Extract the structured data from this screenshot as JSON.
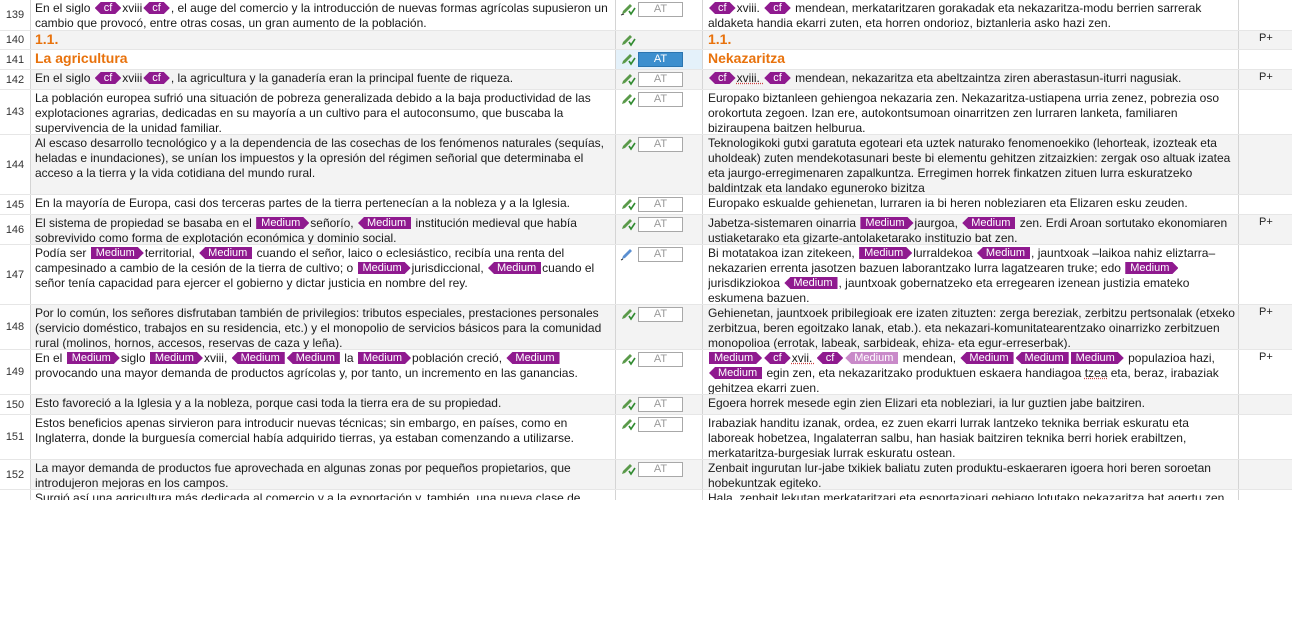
{
  "colors": {
    "tag": "#8f1a8f",
    "tag_light": "#c98ac9",
    "heading": "#e8720c",
    "active_status": "#3c8fce"
  },
  "tag_labels": {
    "cf": "cf",
    "medium": "Medium"
  },
  "icons": {
    "edit": "pencil-check-icon",
    "edit_plain": "pencil-icon"
  },
  "rows": [
    {
      "num": "139",
      "status": "AT",
      "flag": "",
      "src": {
        "a": "En el siglo ",
        "b": "xviii",
        "c": ", el auge del comercio y la introducción de nuevas formas agrícolas supusieron un cambio que provocó, entre otras cosas, un gran aumento de la población."
      },
      "tgt": {
        "a": "xviii. ",
        "b": " mendean, merkataritzaren gorakadak eta nekazaritza-modu berrien sarrerak aldaketa handia ekarri zuten, eta horren ondorioz, biztanleria asko hazi zen."
      }
    },
    {
      "num": "140",
      "status": "",
      "flag": "P+",
      "src": "1.1.",
      "tgt": "1.1."
    },
    {
      "num": "141",
      "status": "AT",
      "flag": "",
      "src": "La agricultura",
      "tgt": "Nekazaritza"
    },
    {
      "num": "142",
      "status": "AT",
      "flag": "P+",
      "src": {
        "a": "En el siglo ",
        "b": "xviii",
        "c": ", la agricultura y la ganadería eran la principal fuente de riqueza."
      },
      "tgt": {
        "a": "xviii. ",
        "b": " mendean, nekazaritza eta abeltzaintza ziren aberastasun-iturri nagusiak."
      }
    },
    {
      "num": "143",
      "status": "AT",
      "flag": "",
      "src": "La población europea sufrió una situación de pobreza generalizada debido a la baja productividad de las explotaciones agrarias, dedicadas en su mayoría a un cultivo para el autoconsumo, que buscaba la supervivencia de la unidad familiar.",
      "tgt": "Europako biztanleen gehiengoa nekazaria zen. Nekazaritza-ustiapena urria zenez, pobrezia oso orokortuta zegoen. Izan ere, autokontsumoan oinarritzen zen lurraren lanketa, familiaren biziraupena baitzen helburua."
    },
    {
      "num": "144",
      "status": "AT",
      "flag": "",
      "src": "Al escaso desarrollo tecnológico y a la dependencia de las cosechas de los fenómenos naturales (sequías, heladas e inundaciones), se unían los impuestos y la opresión del régimen señorial que determinaba el acceso a la tierra y la vida cotidiana del mundo rural.",
      "tgt": "Teknologikoki gutxi garatuta egoteari eta uztek naturako fenomenoekiko (lehorteak, izozteak eta uholdeak) zuten mendekotasunari beste bi elementu gehitzen zitzaizkien: zergak oso altuak izatea eta jaurgo-erregimenaren zapalkuntza. Erregimen horrek finkatzen zituen lurra eskuratzeko baldintzak eta landako eguneroko bizitza"
    },
    {
      "num": "145",
      "status": "AT",
      "flag": "",
      "src": "En la mayoría de Europa, casi dos terceras partes de la tierra pertenecían a la nobleza y a la Iglesia.",
      "tgt": "Europako eskualde gehienetan, lurraren ia bi heren nobleziaren eta Elizaren esku zeuden."
    },
    {
      "num": "146",
      "status": "AT",
      "flag": "P+",
      "src": {
        "a": "El sistema de propiedad se basaba en el ",
        "b": "señorío, ",
        "c": " institución medieval que había sobrevivido como forma de explotación económica y dominio social."
      },
      "tgt": {
        "a": "Jabetza-sistemaren oinarria ",
        "b": "jaurgoa, ",
        "c": " zen. Erdi Aroan sortutako ekonomiaren ustiaketarako eta  gizarte-antolaketarako instituzio bat zen."
      }
    },
    {
      "num": "147",
      "status": "AT",
      "flag": "",
      "src": {
        "a": "Podía ser ",
        "b": "territorial, ",
        "c": " cuando el señor, laico o eclesiástico, recibía una renta del campesinado a cambio de la cesión de la tierra de cultivo; o ",
        "d": "jurisdiccional, ",
        "e": "cuando el señor tenía capacidad para ejercer el gobierno y dictar justicia en nombre del rey."
      },
      "tgt": {
        "a": "Bi motatakoa izan zitekeen, ",
        "b": "lurraldekoa ",
        "c": ", jauntxoak –laikoa nahiz eliztarra– nekazarien errenta jasotzen bazuen laborantzako lurra lagatzearen truke; edo ",
        "d": "jurisdikziokoa ",
        "e": ", jauntxoak gobernatzeko eta erregearen izenean justizia emateko eskumena bazuen."
      }
    },
    {
      "num": "148",
      "status": "AT",
      "flag": "P+",
      "src": "Por lo común, los señores disfrutaban también de privilegios: tributos especiales, prestaciones personales (servicio doméstico, trabajos en su residencia, etc.) y el monopolio de servicios básicos para la comunidad rural (molinos, hornos, accesos, reservas de caza y leña).",
      "tgt": "Gehienetan, jauntxoek pribilegioak ere izaten zituzten: zerga bereziak, zerbitzu pertsonalak (etxeko zerbitzua, beren egoitzako lanak, etab.). eta nekazari-komunitatearentzako oinarrizko zerbitzuen monopolioa (errotak, labeak, sarbideak, ehiza- eta egur-erreserbak)."
    },
    {
      "num": "149",
      "status": "AT",
      "flag": "P+",
      "src": {
        "a": "En el ",
        "b": "siglo ",
        "c": "xviii, ",
        "d": " la ",
        "e": "población creció, ",
        "f": "provocando una mayor demanda de productos agrícolas y, por tanto, un incremento en las ganancias."
      },
      "tgt": {
        "a": "xvii. ",
        "b": " mendean, ",
        "c": " populazioa hazi, ",
        "d": " egin zen, eta nekazaritzako produktuen eskaera handiagoa ",
        "e": "tzea",
        "f": " eta, beraz, irabaziak gehitzea ekarri zuen."
      }
    },
    {
      "num": "150",
      "status": "AT",
      "flag": "",
      "src": "Esto favoreció a la Iglesia y a la nobleza, porque casi toda la tierra era de su propiedad.",
      "tgt": "Egoera horrek mesede egin zien Elizari eta nobleziari, ia lur guztien jabe baitziren."
    },
    {
      "num": "151",
      "status": "AT",
      "flag": "",
      "src": "Estos beneficios apenas sirvieron para introducir nuevas técnicas; sin embargo, en países, como en Inglaterra, donde la burguesía comercial había adquirido tierras, ya estaban comenzando a utilizarse.",
      "tgt": "Irabaziak handitu izanak, ordea, ez zuen ekarri lurrak lantzeko teknika berriak eskuratu eta laboreak hobetzea, Ingalaterran salbu, han hasiak baitziren teknika berri horiek erabiltzen, merkataritza-burgesiak lurrak eskuratu ostean."
    },
    {
      "num": "152",
      "status": "AT",
      "flag": "",
      "src": "La mayor demanda de productos fue aprovechada en algunas zonas por pequeños propietarios, que introdujeron mejoras en los campos.",
      "tgt": "Zenbait ingurutan lur-jabe txikiek baliatu zuten produktu-eskaeraren igoera hori beren soroetan hobekuntzak egiteko."
    },
    {
      "num": "",
      "status": "",
      "flag": "",
      "src": "Surgió así una agricultura más dedicada al comercio y a la exportación y, también, una nueva clase de",
      "tgt": "Hala, zenbait lekutan merkataritzari eta esportazioari gehiago lotutako nekazaritza bat agertu zen"
    }
  ]
}
